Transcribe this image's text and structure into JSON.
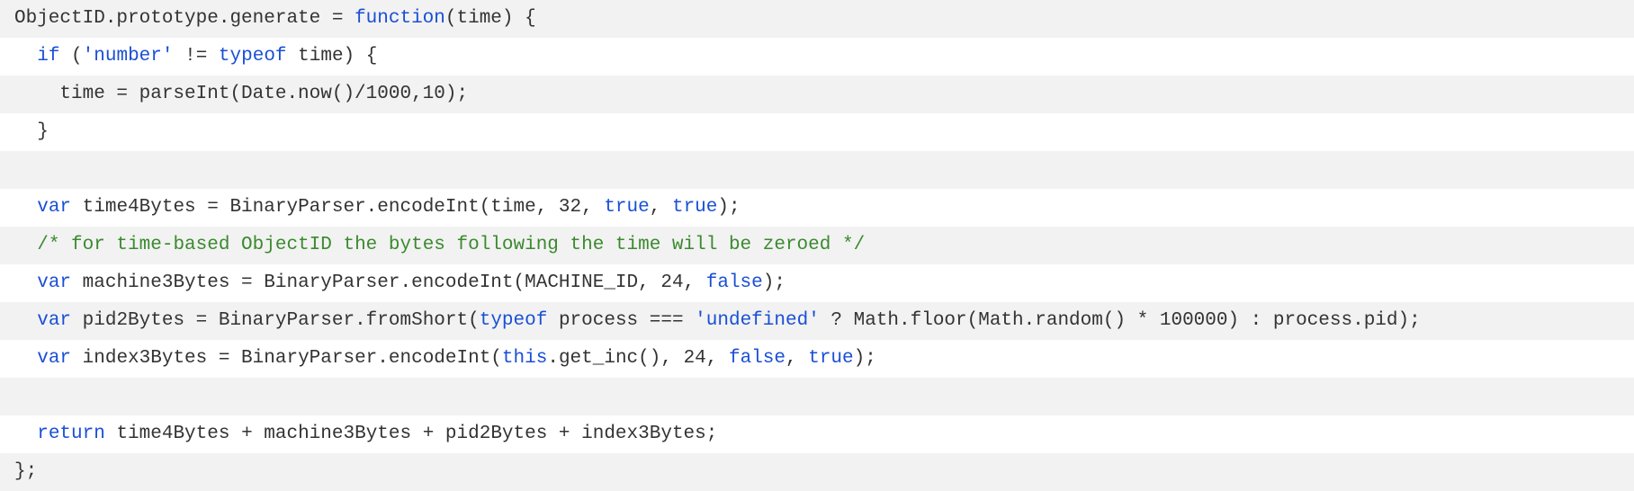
{
  "code": {
    "language": "javascript",
    "colors": {
      "keyword": "#1a4fd6",
      "string": "#1a4fd6",
      "comment": "#3a8a2e",
      "plain": "#333333",
      "stripe_odd": "#f2f2f2",
      "stripe_even": "#ffffff"
    },
    "lines": [
      [
        {
          "t": "pl",
          "v": "ObjectID.prototype.generate = "
        },
        {
          "t": "kw",
          "v": "function"
        },
        {
          "t": "pl",
          "v": "(time) {"
        }
      ],
      [
        {
          "t": "pl",
          "v": "  "
        },
        {
          "t": "kw",
          "v": "if"
        },
        {
          "t": "pl",
          "v": " ("
        },
        {
          "t": "str",
          "v": "'number'"
        },
        {
          "t": "pl",
          "v": " != "
        },
        {
          "t": "kw",
          "v": "typeof"
        },
        {
          "t": "pl",
          "v": " time) {"
        }
      ],
      [
        {
          "t": "pl",
          "v": "    time = parseInt(Date.now()/1000,10);"
        }
      ],
      [
        {
          "t": "pl",
          "v": "  }"
        }
      ],
      [],
      [
        {
          "t": "pl",
          "v": "  "
        },
        {
          "t": "kw",
          "v": "var"
        },
        {
          "t": "pl",
          "v": " time4Bytes = BinaryParser.encodeInt(time, 32, "
        },
        {
          "t": "kw",
          "v": "true"
        },
        {
          "t": "pl",
          "v": ", "
        },
        {
          "t": "kw",
          "v": "true"
        },
        {
          "t": "pl",
          "v": ");"
        }
      ],
      [
        {
          "t": "pl",
          "v": "  "
        },
        {
          "t": "cm",
          "v": "/* for time-based ObjectID the bytes following the time will be zeroed */"
        }
      ],
      [
        {
          "t": "pl",
          "v": "  "
        },
        {
          "t": "kw",
          "v": "var"
        },
        {
          "t": "pl",
          "v": " machine3Bytes = BinaryParser.encodeInt(MACHINE_ID, 24, "
        },
        {
          "t": "kw",
          "v": "false"
        },
        {
          "t": "pl",
          "v": ");"
        }
      ],
      [
        {
          "t": "pl",
          "v": "  "
        },
        {
          "t": "kw",
          "v": "var"
        },
        {
          "t": "pl",
          "v": " pid2Bytes = BinaryParser.fromShort("
        },
        {
          "t": "kw",
          "v": "typeof"
        },
        {
          "t": "pl",
          "v": " process === "
        },
        {
          "t": "str",
          "v": "'undefined'"
        },
        {
          "t": "pl",
          "v": " ? Math.floor(Math.random() * 100000) : process.pid);"
        }
      ],
      [
        {
          "t": "pl",
          "v": "  "
        },
        {
          "t": "kw",
          "v": "var"
        },
        {
          "t": "pl",
          "v": " index3Bytes = BinaryParser.encodeInt("
        },
        {
          "t": "kw",
          "v": "this"
        },
        {
          "t": "pl",
          "v": ".get_inc(), 24, "
        },
        {
          "t": "kw",
          "v": "false"
        },
        {
          "t": "pl",
          "v": ", "
        },
        {
          "t": "kw",
          "v": "true"
        },
        {
          "t": "pl",
          "v": ");"
        }
      ],
      [],
      [
        {
          "t": "pl",
          "v": "  "
        },
        {
          "t": "kw",
          "v": "return"
        },
        {
          "t": "pl",
          "v": " time4Bytes + machine3Bytes + pid2Bytes + index3Bytes;"
        }
      ],
      [
        {
          "t": "pl",
          "v": "};"
        }
      ]
    ]
  }
}
